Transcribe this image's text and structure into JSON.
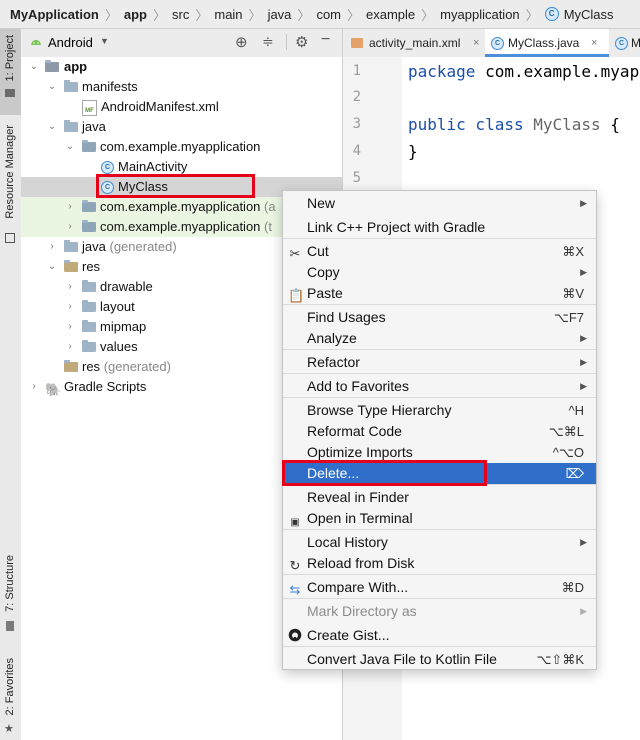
{
  "breadcrumb": [
    "MyApplication",
    "app",
    "src",
    "main",
    "java",
    "com",
    "example",
    "myapplication",
    "MyClass"
  ],
  "left_tool_stripe": {
    "project": "1: Project",
    "resource_manager": "Resource Manager",
    "structure": "7: Structure",
    "favorites": "2: Favorites"
  },
  "project_panel": {
    "view_selector": "Android"
  },
  "tree": [
    {
      "label": "app"
    },
    {
      "label": "manifests"
    },
    {
      "label": "AndroidManifest.xml"
    },
    {
      "label": "java"
    },
    {
      "label": "com.example.myapplication"
    },
    {
      "label": "MainActivity"
    },
    {
      "label": "MyClass"
    },
    {
      "label": "com.example.myapplication",
      "suffix": "(a"
    },
    {
      "label": "com.example.myapplication",
      "suffix": "(t"
    },
    {
      "label": "java",
      "suffix": "(generated)"
    },
    {
      "label": "res"
    },
    {
      "label": "drawable"
    },
    {
      "label": "layout"
    },
    {
      "label": "mipmap"
    },
    {
      "label": "values"
    },
    {
      "label": "res",
      "suffix": "(generated)"
    },
    {
      "label": "Gradle Scripts"
    }
  ],
  "editor": {
    "tabs": [
      "activity_main.xml",
      "MyClass.java",
      "M"
    ],
    "line_numbers": [
      "1",
      "2",
      "3",
      "4",
      "5"
    ],
    "code": {
      "l1_kw": "package",
      "l1_rest": " com.example.myap",
      "l3_kw1": "public",
      "l3_kw2": " class",
      "l3_name": " MyClass",
      "l3_brace": " {",
      "l4": "}"
    }
  },
  "context_menu": {
    "items": [
      {
        "label": "New"
      },
      {
        "label": "Link C++ Project with Gradle"
      },
      {
        "label": "Cut",
        "shortcut": "⌘X"
      },
      {
        "label": "Copy"
      },
      {
        "label": "Paste",
        "shortcut": "⌘V"
      },
      {
        "label": "Find Usages",
        "shortcut": "⌥F7"
      },
      {
        "label": "Analyze"
      },
      {
        "label": "Refactor"
      },
      {
        "label": "Add to Favorites"
      },
      {
        "label": "Browse Type Hierarchy",
        "shortcut": "^H"
      },
      {
        "label": "Reformat Code",
        "shortcut": "⌥⌘L"
      },
      {
        "label": "Optimize Imports",
        "shortcut": "^⌥O"
      },
      {
        "label": "Delete...",
        "shortcut": "⌦"
      },
      {
        "label": "Reveal in Finder"
      },
      {
        "label": "Open in Terminal"
      },
      {
        "label": "Local History"
      },
      {
        "label": "Reload from Disk"
      },
      {
        "label": "Compare With...",
        "shortcut": "⌘D"
      },
      {
        "label": "Mark Directory as"
      },
      {
        "label": "Create Gist..."
      },
      {
        "label": "Convert Java File to Kotlin File",
        "shortcut": "⌥⇧⌘K"
      }
    ],
    "highlighted": "Delete..."
  },
  "colors": {
    "accent": "#2f6fca",
    "highlight_box": "#e6001a",
    "keyword": "#1b4ea8"
  }
}
